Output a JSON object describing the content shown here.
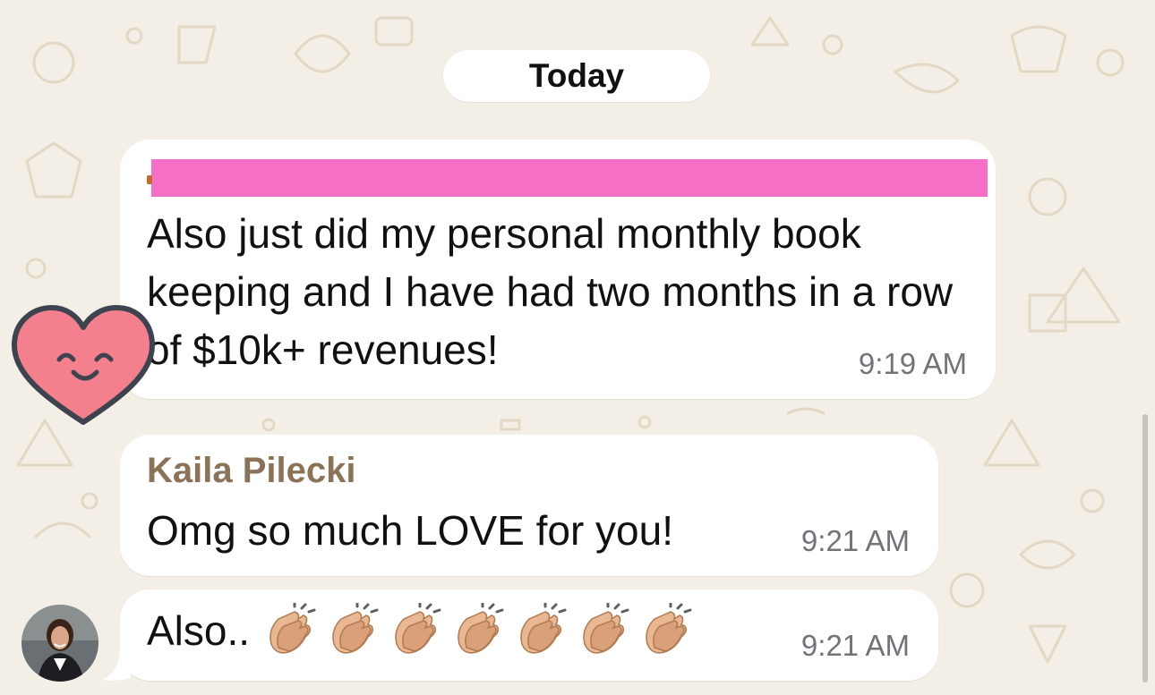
{
  "chat": {
    "date_separator": "Today",
    "messages": [
      {
        "text": "Also just did my personal monthly book keeping and I have had two months in a row of $10k+ revenues!",
        "time": "9:19 AM",
        "reaction_icon": "smiling-heart-sticker-icon"
      },
      {
        "sender": "Kaila Pilecki",
        "text": "Omg so much LOVE for you!",
        "time": "9:21 AM"
      },
      {
        "text": "Also..",
        "emoji": [
          "clapping-hands",
          "clapping-hands",
          "clapping-hands",
          "clapping-hands",
          "clapping-hands",
          "clapping-hands",
          "clapping-hands"
        ],
        "time": "9:21 AM"
      }
    ]
  },
  "colors": {
    "background": "#f4efe6",
    "bubble": "#ffffff",
    "sender_name": "#8b7358",
    "redaction": "#f66fc7",
    "heart": "#f47f8d"
  }
}
